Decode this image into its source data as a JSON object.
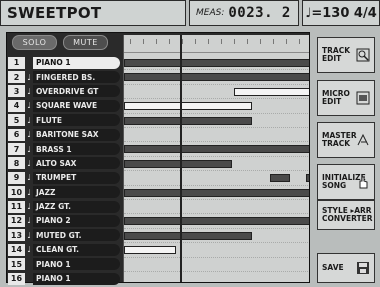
{
  "header": {
    "title": "SWEETPOT",
    "meas_label": "MEAS:",
    "meas_value": "0023. 2",
    "tempo": "♩=130  4/4"
  },
  "controls": {
    "solo": "SOLO",
    "mute": "MUTE"
  },
  "tracks": [
    {
      "num": "1",
      "name": "PIANO 1",
      "selected": true,
      "note": false
    },
    {
      "num": "2",
      "name": "FINGERED BS.",
      "note": true
    },
    {
      "num": "3",
      "name": "OVERDRIVE GT",
      "note": true
    },
    {
      "num": "4",
      "name": "SQUARE WAVE",
      "note": true
    },
    {
      "num": "5",
      "name": "FLUTE",
      "note": true
    },
    {
      "num": "6",
      "name": "BARITONE SAX",
      "note": true
    },
    {
      "num": "7",
      "name": "BRASS 1",
      "note": true
    },
    {
      "num": "8",
      "name": "ALTO SAX",
      "note": true
    },
    {
      "num": "9",
      "name": "TRUMPET",
      "note": true
    },
    {
      "num": "10",
      "name": "JAZZ",
      "note": true
    },
    {
      "num": "11",
      "name": "JAZZ GT.",
      "note": true
    },
    {
      "num": "12",
      "name": "PIANO 2",
      "note": true
    },
    {
      "num": "13",
      "name": "MUTED GT.",
      "note": true
    },
    {
      "num": "14",
      "name": "CLEAN GT.",
      "note": true
    },
    {
      "num": "15",
      "name": "PIANO 1",
      "note": false
    },
    {
      "num": "16",
      "name": "PIANO 1",
      "note": false
    }
  ],
  "buttons": {
    "track_edit": [
      "TRACK",
      "EDIT"
    ],
    "micro_edit": [
      "MICRO",
      "EDIT"
    ],
    "master_track": [
      "MASTER",
      "TRACK"
    ],
    "initialize_song": [
      "INITIALIZE",
      "SONG"
    ],
    "style_arr": [
      "STYLE ▸ARR",
      "CONVERTER"
    ],
    "save": "SAVE"
  }
}
